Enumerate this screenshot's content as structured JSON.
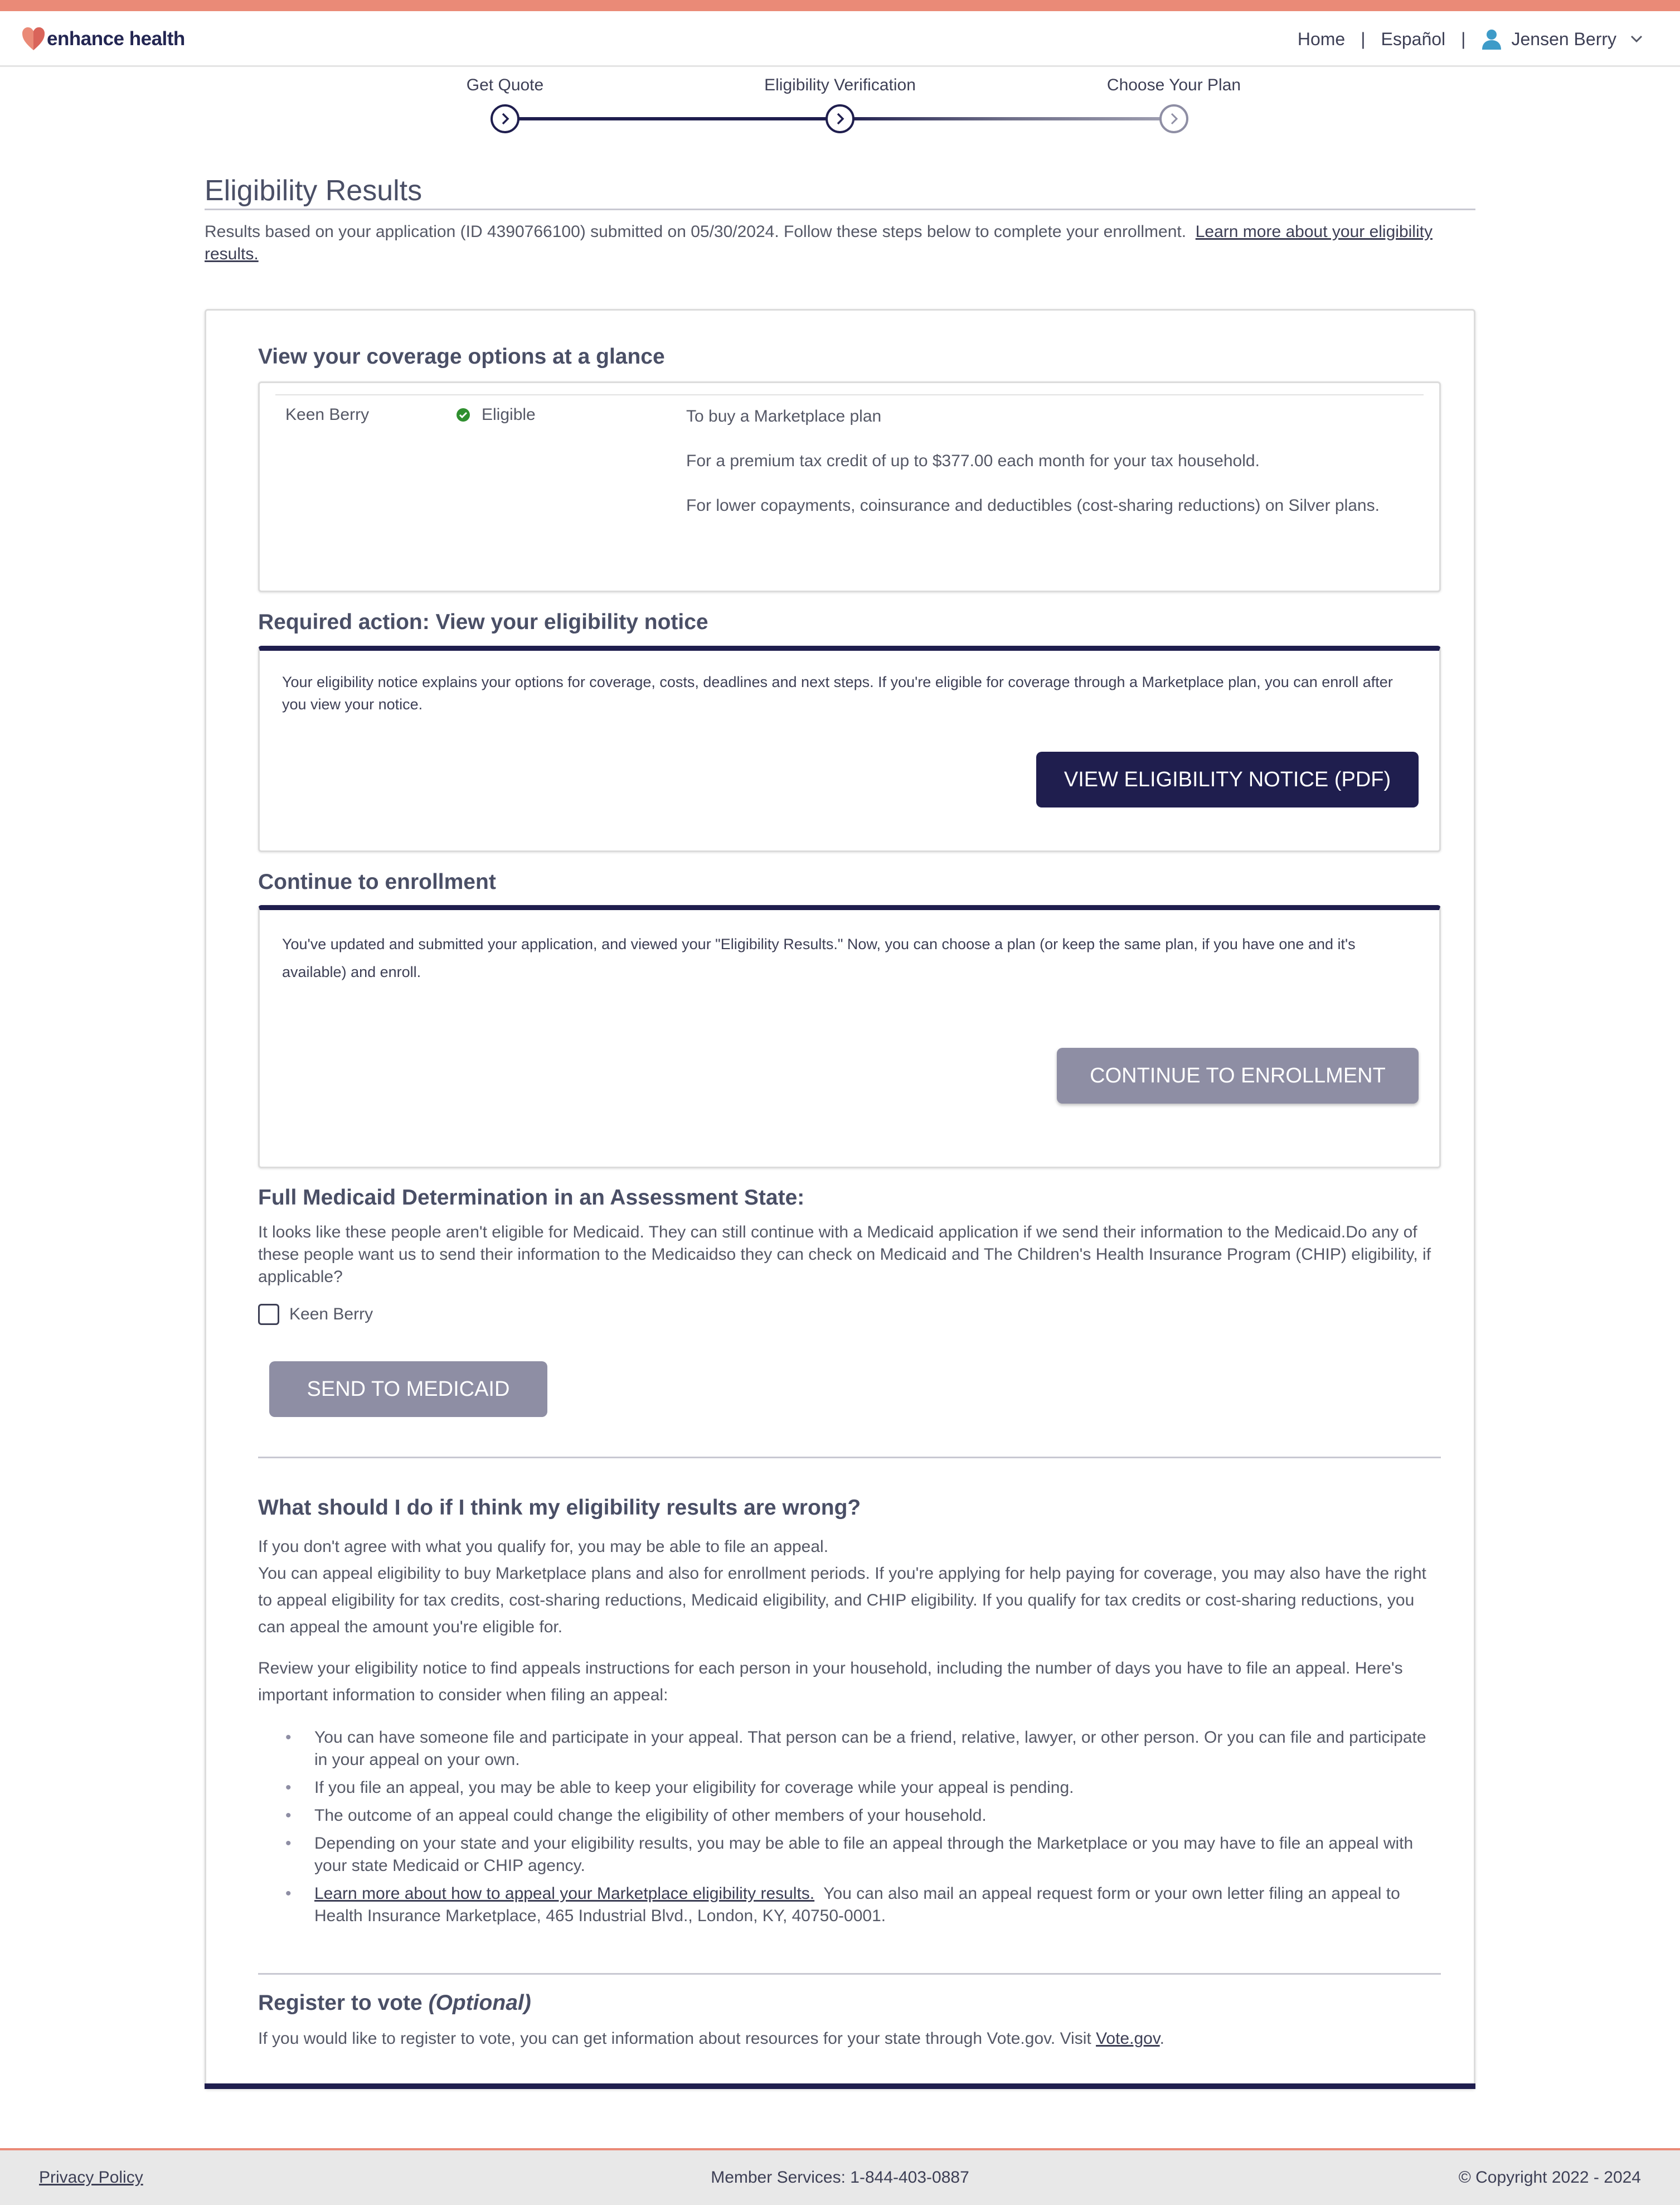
{
  "brand": {
    "name": "enhance health",
    "accent_color": "#ea8a77",
    "primary_color": "#1f1e4e",
    "disabled_button_color": "#8e8ea4"
  },
  "nav": {
    "home": "Home",
    "language": "Español",
    "separator": "|",
    "user_name": "Jensen Berry"
  },
  "stepper": {
    "steps": [
      {
        "label": "Get Quote",
        "state": "complete"
      },
      {
        "label": "Eligibility Verification",
        "state": "current"
      },
      {
        "label": "Choose Your Plan",
        "state": "upcoming"
      }
    ]
  },
  "page": {
    "title": "Eligibility Results",
    "intro_text": "Results based on your application (ID 4390766100) submitted on 05/30/2024. Follow these steps below to complete your enrollment.",
    "intro_link": "Learn more about your eligibility results."
  },
  "glance": {
    "title": "View your coverage options at a glance",
    "person_name": "Keen Berry",
    "status": "Eligible",
    "reasons": [
      "To buy a Marketplace plan",
      "For a premium tax credit of up to $377.00 each month for your tax household.",
      "For lower copayments, coinsurance and deductibles (cost-sharing reductions) on Silver plans."
    ]
  },
  "notice": {
    "title": "Required action: View your eligibility notice",
    "text": "Your eligibility notice explains your options for coverage, costs, deadlines and next steps. If you're eligible for coverage through a Marketplace plan, you can enroll after you view your notice.",
    "button": "VIEW ELIGIBILITY NOTICE (PDF)"
  },
  "enrollment": {
    "title": "Continue to enrollment",
    "text": "You've updated and submitted your application, and viewed your \"Eligibility Results.\" Now, you can choose a plan (or keep the same plan, if you have one and it's available) and enroll.",
    "button": "CONTINUE TO ENROLLMENT"
  },
  "medicaid": {
    "title": "Full Medicaid Determination in an Assessment State:",
    "text": "It looks like these people aren't eligible for Medicaid. They can still continue with a Medicaid application if we send their information to the Medicaid.Do any of these people want us to send their information to the Medicaidso they can check on Medicaid and The Children's Health Insurance Program (CHIP) eligibility, if applicable?",
    "checkbox_label": "Keen Berry",
    "checkbox_checked": false,
    "button": "SEND TO MEDICAID"
  },
  "faq": {
    "title": "What should I do if I think my eligibility results are wrong?",
    "line1": "If you don't agree with what you qualify for, you may be able to file an appeal.",
    "line2": "You can appeal eligibility to buy Marketplace plans and also for enrollment periods. If you're applying for help paying for coverage, you may also have the right to appeal eligibility for tax credits, cost-sharing reductions, Medicaid eligibility, and CHIP eligibility. If you qualify for tax credits or cost-sharing reductions, you can appeal the amount you're eligible for.",
    "para2": "Review your eligibility notice to find appeals instructions for each person in your household, including the number of days you have to file an appeal. Here's important information to consider when filing an appeal:",
    "bullets": [
      "You can have someone file and participate in your appeal. That person can be a friend, relative, lawyer, or other person. Or you can file and participate in your appeal on your own.",
      "If you file an appeal, you may be able to keep your eligibility for coverage while your appeal is pending.",
      "The outcome of an appeal could change the eligibility of other members of your household.",
      "Depending on your state and your eligibility results, you may be able to file an appeal through the Marketplace or you may have to file an appeal with your state Medicaid or CHIP agency."
    ],
    "last_bullet_link": "Learn more about how to appeal your Marketplace eligibility results.",
    "last_bullet_text": "You can also mail an appeal request form or your own letter filing an appeal to Health Insurance Marketplace, 465 Industrial Blvd., London, KY, 40750-0001."
  },
  "vote": {
    "title": "Register to vote",
    "title_optional": "(Optional)",
    "text": "If you would like to register to vote, you can get information about resources for your state through Vote.gov. Visit",
    "link": "Vote.gov",
    "text_end": "."
  },
  "footer": {
    "privacy": "Privacy Policy",
    "services": "Member Services: 1-844-403-0887",
    "copyright": "© Copyright 2022 - 2024"
  }
}
